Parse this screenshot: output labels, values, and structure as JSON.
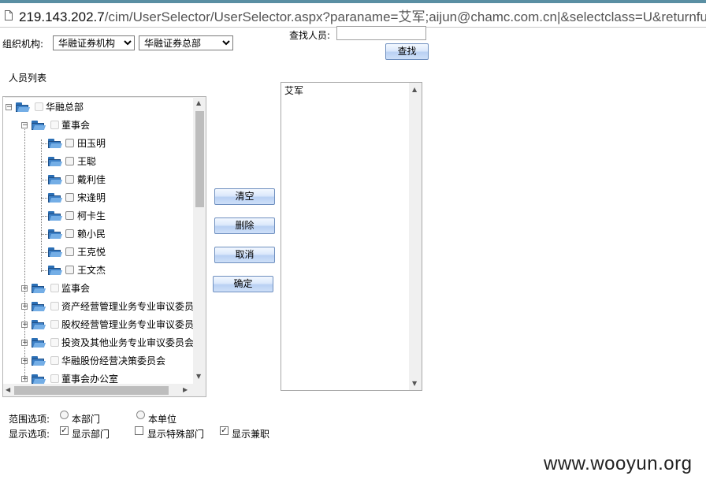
{
  "browser": {
    "url_host": "219.143.202.7",
    "url_rest": "/cim/UserSelector/UserSelector.aspx?paraname=艾军;aijun@chamc.com.cn|&selectclass=U&returnfu"
  },
  "form": {
    "org_label": "组织机构:",
    "org_select_1": "华融证券机构",
    "org_select_2": "华融证券总部",
    "find_label": "查找人员:",
    "find_value": "",
    "find_button": "查找",
    "person_list_label": "人员列表"
  },
  "tree": {
    "root": "华融总部",
    "board": "董事会",
    "members": [
      "田玉明",
      "王聪",
      "戴利佳",
      "宋逢明",
      "柯卡生",
      "赖小民",
      "王克悦",
      "王文杰"
    ],
    "other_groups": [
      "监事会",
      "资产经营管理业务专业审议委员",
      "股权经营管理业务专业审议委员",
      "投资及其他业务专业审议委员会",
      "华融股份经营决策委员会",
      "董事会办公室"
    ]
  },
  "actions": {
    "clear": "清空",
    "delete": "删除",
    "cancel": "取消",
    "confirm": "确定"
  },
  "selected_list": [
    "艾军"
  ],
  "options": {
    "scope_label": "范围选项:",
    "scope_dept": "本部门",
    "scope_unit": "本单位",
    "display_label": "显示选项:",
    "show_dept": "显示部门",
    "show_special_dept": "显示特殊部门",
    "show_concurrent": "显示兼职",
    "show_dept_checked": true,
    "show_special_dept_checked": false,
    "show_concurrent_checked": true
  },
  "watermark": "www.wooyun.org"
}
